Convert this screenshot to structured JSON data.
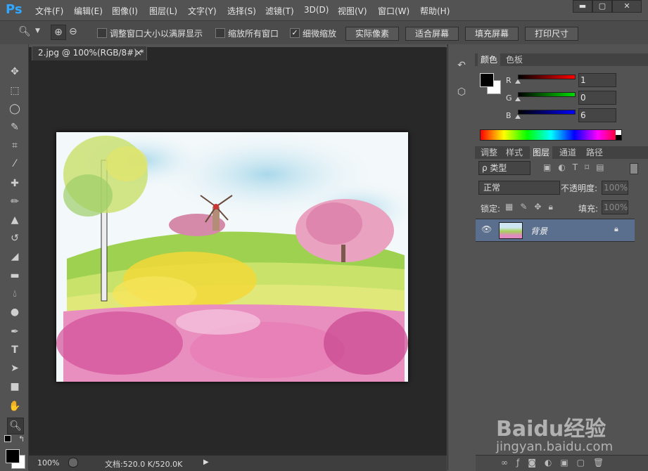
{
  "app": {
    "logo": "Ps"
  },
  "menu": [
    "文件(F)",
    "编辑(E)",
    "图像(I)",
    "图层(L)",
    "文字(Y)",
    "选择(S)",
    "滤镜(T)",
    "3D(D)",
    "视图(V)",
    "窗口(W)",
    "帮助(H)"
  ],
  "window_controls": {
    "minimize": "▬",
    "maximize": "▢",
    "close": "✕"
  },
  "options": {
    "fit_window_label": "调整窗口大小以满屏显示",
    "zoom_all_label": "缩放所有窗口",
    "scrubby_label": "细微缩放",
    "scrubby_checked": "✓",
    "actual_pixels": "实际像素",
    "fit_screen": "适合屏幕",
    "fill_screen": "填充屏幕",
    "print_size": "打印尺寸"
  },
  "document": {
    "tab_title": "2.jpg @ 100%(RGB/8#) *",
    "tab_close": "×"
  },
  "status": {
    "zoom": "100%",
    "doc_info": "文档:520.0 K/520.0K",
    "arrow": "▶"
  },
  "color_panel": {
    "tabs": [
      "颜色",
      "色板"
    ],
    "r_label": "R",
    "g_label": "G",
    "b_label": "B",
    "r_value": "1",
    "g_value": "0",
    "b_value": "6"
  },
  "layers_panel": {
    "tabs": [
      "调整",
      "样式",
      "图层",
      "通道",
      "路径"
    ],
    "filter_label": "ρ 类型",
    "blend_mode": "正常",
    "opacity_label": "不透明度:",
    "opacity_value": "100%",
    "lock_label": "锁定:",
    "fill_label": "填充:",
    "fill_value": "100%",
    "layer_name": "背景"
  },
  "watermark": {
    "brand": "Baidu经验",
    "url": "jingyan.baidu.com"
  },
  "colors": {
    "accent": "#31a8ff",
    "panel": "#535353",
    "canvas_bg": "#282828",
    "selected_layer": "#5a6f8e"
  }
}
